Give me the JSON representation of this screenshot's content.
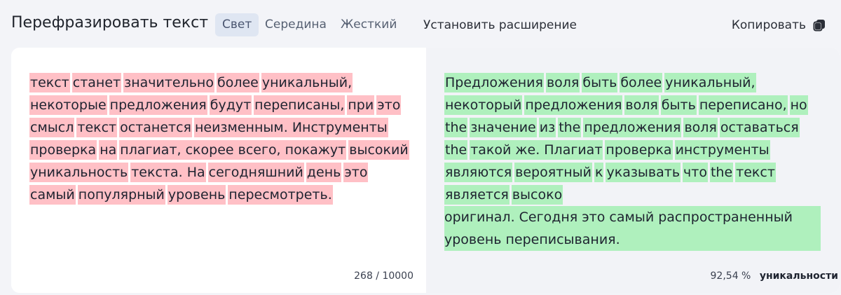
{
  "header": {
    "title": "Перефразировать текст",
    "modes": [
      {
        "label": "Свет",
        "active": true
      },
      {
        "label": "Середина",
        "active": false
      },
      {
        "label": "Жесткий",
        "active": false
      }
    ],
    "install_label": "Установить расширение",
    "copy_label": "Копировать",
    "copy_icon": "copy-icon"
  },
  "input": {
    "lines": [
      [
        "текст",
        "станет",
        "значительно",
        "более",
        "уникальный,"
      ],
      [
        "некоторые",
        "предложения",
        "будут",
        "переписаны,",
        "при",
        "это"
      ],
      [
        "смысл",
        "текст",
        "останется",
        "неизменным. Инструменты"
      ],
      [
        "проверка",
        "на",
        "плагиат, скорее всего, покажут",
        "высокий"
      ],
      [
        "уникальность",
        "текста. На",
        "сегодняшний",
        "день",
        "это"
      ],
      [
        "самый",
        "популярный",
        "уровень",
        "пересмотреть."
      ]
    ],
    "counter": "268 / 10000"
  },
  "output": {
    "lines": [
      [
        "Предложения",
        "воля",
        "быть",
        "более",
        "уникальный,"
      ],
      [
        "некоторый",
        "предложения",
        "воля",
        "быть",
        "переписано,",
        "но"
      ],
      [
        "the",
        "значение",
        "из",
        "the",
        "предложения",
        "воля",
        "оставаться"
      ],
      [
        "the",
        "такой же. Плагиат",
        "проверка",
        "инструменты"
      ],
      [
        "являются",
        "вероятный",
        "к",
        "указывать",
        "что",
        "the",
        "текст"
      ],
      [
        "является",
        "высоко"
      ]
    ],
    "full_lines": [
      "оригинал. Сегодня это самый распространенный",
      "уровень переписывания."
    ],
    "uniqueness_value": "92,54 %",
    "uniqueness_label": "уникальности"
  },
  "colors": {
    "removed_highlight": "#ffc0c6",
    "added_highlight": "#aff0bd"
  }
}
